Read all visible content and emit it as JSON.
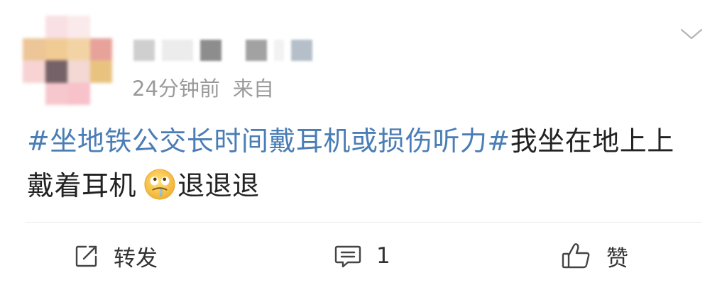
{
  "post": {
    "meta": {
      "time": "24分钟前",
      "source": "来自"
    },
    "content": {
      "topic": "#坐地铁公交长时间戴耳机或损伤听力#",
      "text_before_emoji": "我坐在地上上戴着耳机",
      "emoji": "drooling-face-emoji",
      "text_after_emoji": "退退退"
    },
    "actions": {
      "repost_label": "转发",
      "comment_count": "1",
      "like_label": "赞"
    }
  },
  "icons": {
    "menu": "chevron-down-icon",
    "repost": "share-edit-icon",
    "comment": "comment-bubble-icon",
    "like": "thumbs-up-icon"
  },
  "colors": {
    "topic": "#4a7db5",
    "meta_text": "#9a9a9a",
    "body_text": "#222222"
  }
}
